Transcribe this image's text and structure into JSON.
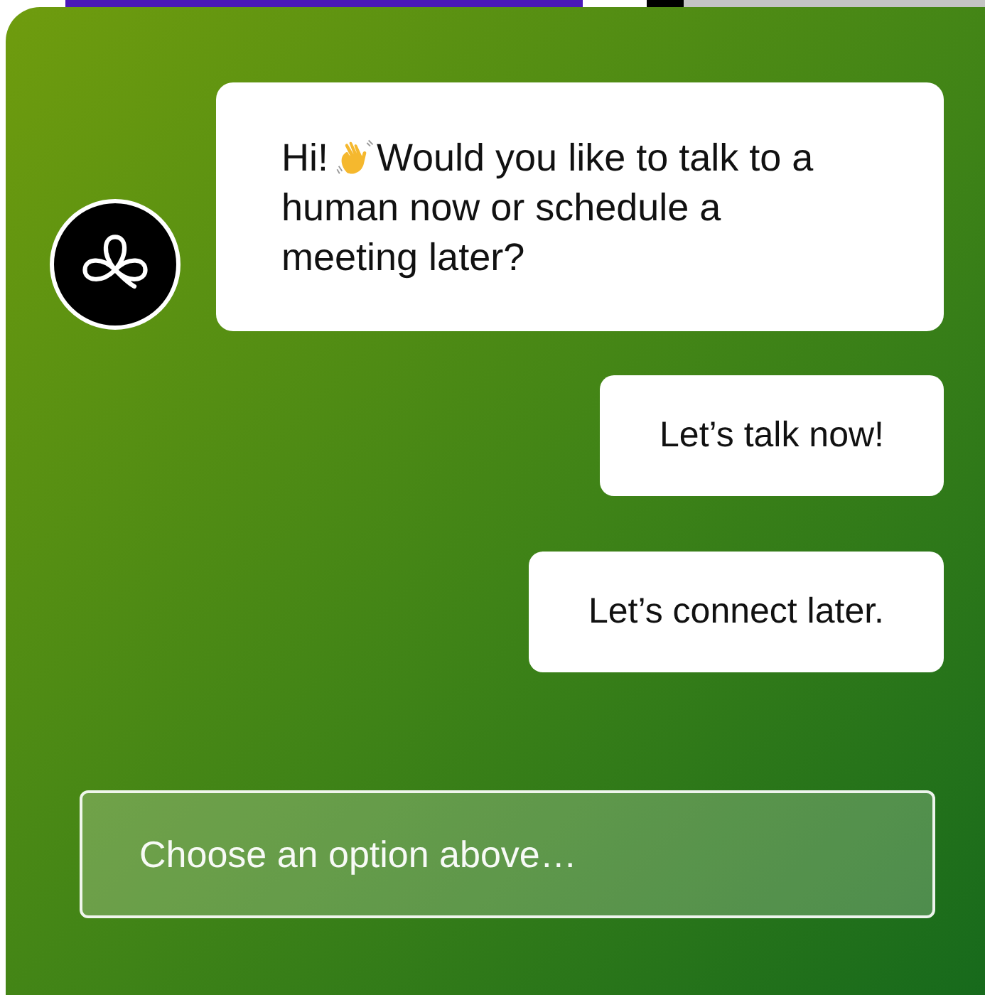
{
  "message": {
    "greeting": "Hi!",
    "text": "Would you like to talk to a human now or schedule a meeting later?"
  },
  "options": [
    {
      "label": "Let’s talk now!"
    },
    {
      "label": "Let’s connect later."
    }
  ],
  "input": {
    "placeholder": "Choose an option above…"
  }
}
